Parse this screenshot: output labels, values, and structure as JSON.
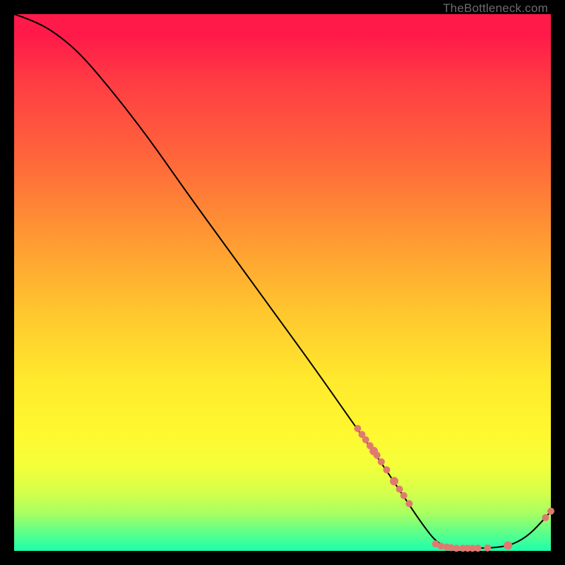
{
  "watermark": "TheBottleneck.com",
  "colors": {
    "background_black": "#000000",
    "curve": "#000000",
    "dot": "#e07a6f",
    "gradient_top": "#ff1a49",
    "gradient_bottom": "#1cffae"
  },
  "chart_data": {
    "type": "line",
    "title": "",
    "xlabel": "",
    "ylabel": "",
    "xlim": [
      0,
      100
    ],
    "ylim": [
      0,
      100
    ],
    "grid": false,
    "legend": false,
    "description": "Curve starts at upper-left near y≈100, descends steeply and almost linearly to a flat minimum near y≈0 around x≈78–92, then rises slightly at the right edge. Salmon dots cluster along the descending segment around x≈64–74 and along the flat minimum x≈78–92, plus two near x≈99–100.",
    "curve_points": [
      {
        "x": 0,
        "y": 100
      },
      {
        "x": 3,
        "y": 99
      },
      {
        "x": 7,
        "y": 97
      },
      {
        "x": 12,
        "y": 93
      },
      {
        "x": 18,
        "y": 86
      },
      {
        "x": 25,
        "y": 77
      },
      {
        "x": 32,
        "y": 67
      },
      {
        "x": 40,
        "y": 56
      },
      {
        "x": 48,
        "y": 45
      },
      {
        "x": 56,
        "y": 34
      },
      {
        "x": 63,
        "y": 24
      },
      {
        "x": 68,
        "y": 17
      },
      {
        "x": 72,
        "y": 11
      },
      {
        "x": 76,
        "y": 5
      },
      {
        "x": 79,
        "y": 1.2
      },
      {
        "x": 82,
        "y": 0.5
      },
      {
        "x": 86,
        "y": 0.5
      },
      {
        "x": 90,
        "y": 0.6
      },
      {
        "x": 93,
        "y": 1.2
      },
      {
        "x": 96,
        "y": 3.0
      },
      {
        "x": 99,
        "y": 6.2
      },
      {
        "x": 100,
        "y": 7.4
      }
    ],
    "dots": [
      {
        "x": 64.0,
        "y": 22.8,
        "r": 1.0
      },
      {
        "x": 64.8,
        "y": 21.7,
        "r": 1.0
      },
      {
        "x": 65.5,
        "y": 20.7,
        "r": 1.0
      },
      {
        "x": 66.3,
        "y": 19.6,
        "r": 1.0
      },
      {
        "x": 67.0,
        "y": 18.6,
        "r": 1.2
      },
      {
        "x": 67.6,
        "y": 17.8,
        "r": 1.0
      },
      {
        "x": 68.4,
        "y": 16.6,
        "r": 1.0
      },
      {
        "x": 69.4,
        "y": 15.1,
        "r": 1.0
      },
      {
        "x": 70.8,
        "y": 13.0,
        "r": 1.2
      },
      {
        "x": 71.8,
        "y": 11.5,
        "r": 1.0
      },
      {
        "x": 72.6,
        "y": 10.3,
        "r": 1.0
      },
      {
        "x": 73.6,
        "y": 8.8,
        "r": 1.0
      },
      {
        "x": 78.5,
        "y": 1.3,
        "r": 1.0
      },
      {
        "x": 79.5,
        "y": 0.9,
        "r": 1.0
      },
      {
        "x": 80.6,
        "y": 0.7,
        "r": 1.0
      },
      {
        "x": 81.4,
        "y": 0.6,
        "r": 1.0
      },
      {
        "x": 82.4,
        "y": 0.5,
        "r": 1.0
      },
      {
        "x": 83.6,
        "y": 0.5,
        "r": 1.0
      },
      {
        "x": 84.5,
        "y": 0.5,
        "r": 1.0
      },
      {
        "x": 85.4,
        "y": 0.5,
        "r": 1.0
      },
      {
        "x": 86.4,
        "y": 0.5,
        "r": 1.0
      },
      {
        "x": 88.2,
        "y": 0.55,
        "r": 1.0
      },
      {
        "x": 92.0,
        "y": 1.0,
        "r": 1.2
      },
      {
        "x": 99.0,
        "y": 6.2,
        "r": 1.0
      },
      {
        "x": 100.0,
        "y": 7.4,
        "r": 1.0
      }
    ]
  }
}
